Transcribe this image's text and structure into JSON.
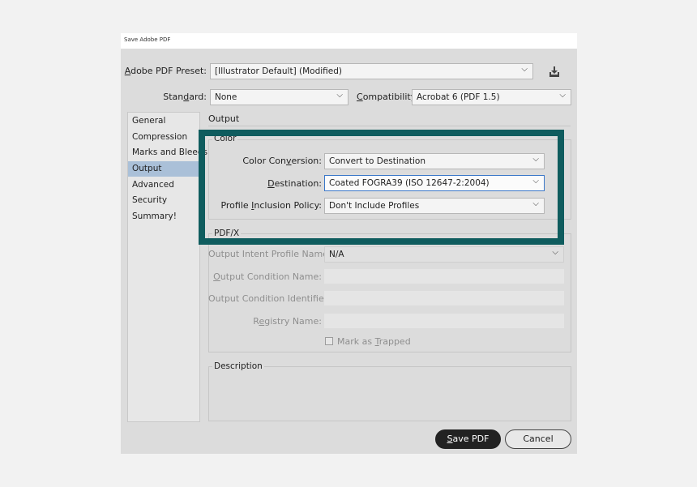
{
  "window": {
    "title": "Save Adobe PDF"
  },
  "preset": {
    "label_accel": "A",
    "label_rest": "dobe PDF Preset:",
    "value": "[Illustrator Default] (Modified)"
  },
  "standard": {
    "label_pre": "Stan",
    "label_accel": "d",
    "label_post": "ard:",
    "value": "None"
  },
  "compatibility": {
    "label_accel": "C",
    "label_rest": "ompatibility:",
    "value": "Acrobat 6 (PDF 1.5)"
  },
  "sidebar": {
    "items": [
      {
        "label": "General"
      },
      {
        "label": "Compression"
      },
      {
        "label": "Marks and Bleeds"
      },
      {
        "label": "Output"
      },
      {
        "label": "Advanced"
      },
      {
        "label": "Security"
      },
      {
        "label": "Summary!"
      }
    ],
    "selected": "Output"
  },
  "panel": {
    "title": "Output"
  },
  "color_group": {
    "legend": "Color",
    "conversion": {
      "label_pre": "Color Con",
      "label_accel": "v",
      "label_post": "ersion:",
      "value": "Convert to Destination"
    },
    "destination": {
      "label_accel": "D",
      "label_rest": "estination:",
      "value": "Coated FOGRA39 (ISO 12647-2:2004)"
    },
    "profile_policy": {
      "label_pre": "Profile ",
      "label_accel": "I",
      "label_post": "nclusion Policy:",
      "value": "Don't Include Profiles"
    }
  },
  "pdfx_group": {
    "legend": "PDF/X",
    "output_intent": {
      "label": "Output Intent Profile Name:",
      "value": "N/A"
    },
    "condition_name": {
      "label_accel": "O",
      "label_rest": "utput Condition Name:"
    },
    "condition_identifier": {
      "label": "Output Condition Identifier:"
    },
    "registry_name": {
      "label_pre": "R",
      "label_accel": "e",
      "label_post": "gistry Name:"
    },
    "trapped": {
      "label_pre": "Mark as ",
      "label_accel": "T",
      "label_post": "rapped"
    }
  },
  "description_group": {
    "legend": "Description"
  },
  "buttons": {
    "save": {
      "accel": "S",
      "rest": "ave PDF"
    },
    "cancel": "Cancel"
  },
  "highlight_color": "#0f5c5e"
}
